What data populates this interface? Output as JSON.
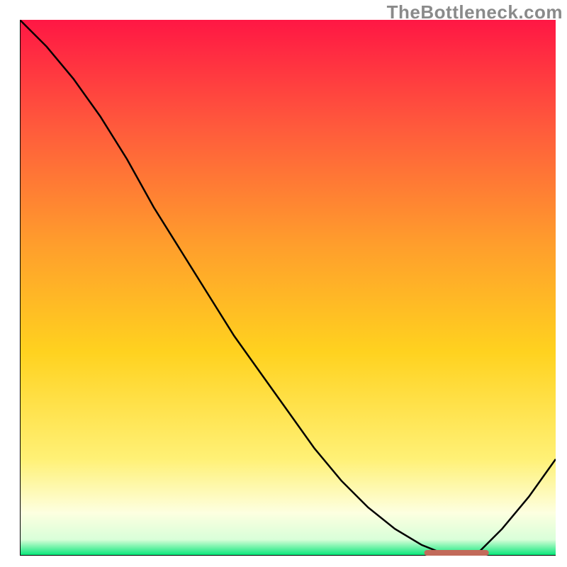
{
  "watermark": "TheBottleneck.com",
  "chart_data": {
    "type": "line",
    "title": "",
    "xlabel": "",
    "ylabel": "",
    "xlim": [
      0,
      100
    ],
    "ylim": [
      0,
      100
    ],
    "grid": false,
    "legend": false,
    "x": [
      0,
      5,
      10,
      15,
      20,
      25,
      30,
      35,
      40,
      45,
      50,
      55,
      60,
      65,
      70,
      75,
      80,
      85,
      90,
      95,
      100
    ],
    "values": [
      100,
      95,
      89,
      82,
      74,
      65,
      57,
      49,
      41,
      34,
      27,
      20,
      14,
      9,
      5,
      2,
      0,
      0,
      5,
      11,
      18
    ],
    "min_segment": {
      "x_start": 76,
      "x_end": 87,
      "y": 0
    },
    "gradient_stops": [
      {
        "offset": 0.0,
        "color": "#ff1744"
      },
      {
        "offset": 0.2,
        "color": "#ff5a3c"
      },
      {
        "offset": 0.42,
        "color": "#ff9e2c"
      },
      {
        "offset": 0.62,
        "color": "#ffd21f"
      },
      {
        "offset": 0.82,
        "color": "#fff176"
      },
      {
        "offset": 0.92,
        "color": "#fdffe0"
      },
      {
        "offset": 0.97,
        "color": "#d9ffd9"
      },
      {
        "offset": 1.0,
        "color": "#00e676"
      }
    ],
    "min_segment_color": "#c26a5a"
  }
}
